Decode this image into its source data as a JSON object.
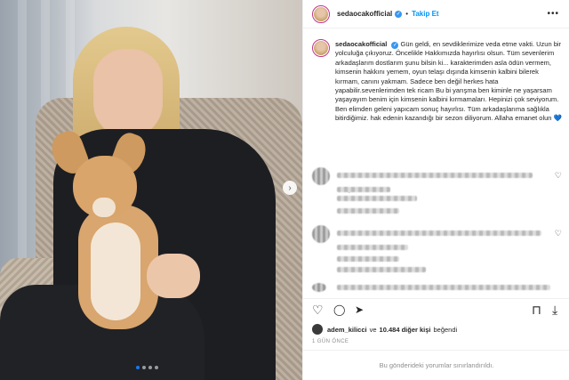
{
  "post": {
    "username": "sedaocakofficial",
    "follow_label": "Takip Et",
    "separator": "•",
    "more_glyph": "•••",
    "caption": "Gün geldi, en sevdiklerimize veda etme vakti. Uzun bir yolculuğa çıkıyoruz. Öncelikle Hakkımızda hayırlısı olsun. Tüm sevenlerim arkadaşlarım dostlarım şunu bilsin ki... karakterimden asla ödün vermem, kimsenin hakkını yemem, oyun telaşı dışında kimsenin kalbini bilerek kırmam, canını yakmam. Sadece ben değil herkes hata yapabilir.sevenlerimden tek ricam Bu bi yarışma ben kiminle ne yaşarsam yaşayayım benim için kimsenin kalbini kırmamaları. Hepinizi çok seviyorum. Ben elimden geleni yapıcam sonuç hayırlısı. Tüm arkadaşlarıma sağlıkla bitirdiğimiz. hak edenin kazandığı bir sezon diliyorum. Allaha emanet olun",
    "caption_emoji": "💙",
    "age": "1g",
    "likes_user": "adem_kilicci",
    "likes_connector": "ve",
    "likes_count": "10.484 diğer kişi",
    "likes_suffix": "beğendi",
    "timestamp": "1 GÜN ÖNCE",
    "comments_disabled": "Bu gönderideki yorumlar sınırlandırıldı."
  },
  "icons": {
    "verified": "✓",
    "next": "›",
    "like": "♡",
    "comment": "◯",
    "share": "➤",
    "save": "⊓",
    "download": "⤓",
    "comment_like": "♡"
  },
  "colors": {
    "accent": "#0095f6",
    "verified": "#3897f0",
    "muted": "#8e8e8e",
    "carousel_active": "#1877f2"
  }
}
